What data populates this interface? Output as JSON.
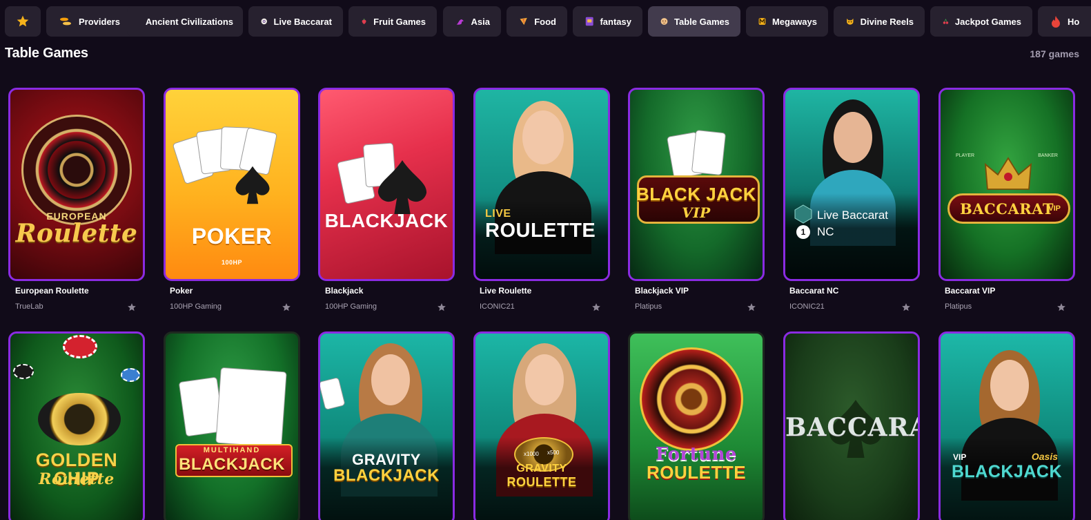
{
  "categories": [
    {
      "label": "",
      "icon": "star-icon",
      "color": "#f5b21b"
    },
    {
      "label": "Providers",
      "icon": "coins-icon",
      "color": "#f59e0b"
    },
    {
      "label": "Ancient Civilizations",
      "icon": "none",
      "color": ""
    },
    {
      "label": "Live Baccarat",
      "icon": "chip-icon",
      "color": "#e6e6e6"
    },
    {
      "label": "Fruit Games",
      "icon": "strawberry-icon",
      "color": "#e03c4e"
    },
    {
      "label": "Asia",
      "icon": "dragon-icon",
      "color": "#b83bd4"
    },
    {
      "label": "Food",
      "icon": "pizza-icon",
      "color": "#f0a43a"
    },
    {
      "label": "fantasy",
      "icon": "book-icon",
      "color": "#8a4dd6"
    },
    {
      "label": "Table Games",
      "icon": "dice-icon",
      "color": "#f2c48c"
    },
    {
      "label": "Megaways",
      "icon": "m-icon",
      "color": "#f5b21b"
    },
    {
      "label": "Divine Reels",
      "icon": "helmet-icon",
      "color": "#f5b21b"
    },
    {
      "label": "Jackpot Games",
      "icon": "cherry-icon",
      "color": "#e03c4e"
    },
    {
      "label": "Ho",
      "icon": "fire-icon",
      "color": "#e8443a"
    }
  ],
  "active_category": "Table Games",
  "section": {
    "title": "Table Games",
    "count": "187 games"
  },
  "games": [
    {
      "name": "European Roulette",
      "provider": "TrueLab",
      "art_lines": [
        "EUROPEAN",
        "Roulette"
      ]
    },
    {
      "name": "Poker",
      "provider": "100HP Gaming",
      "art_lines": [
        "POKER",
        "100HP"
      ]
    },
    {
      "name": "Blackjack",
      "provider": "100HP Gaming",
      "art_lines": [
        "BLACKJACK"
      ]
    },
    {
      "name": "Live Roulette",
      "provider": "ICONIC21",
      "art_lines": [
        "LIVE",
        "ROULETTE"
      ]
    },
    {
      "name": "Blackjack VIP",
      "provider": "Platipus",
      "art_lines": [
        "BLACK JACK",
        "VIP"
      ]
    },
    {
      "name": "Baccarat NC",
      "provider": "ICONIC21",
      "art_lines": [
        "Live Baccarat",
        "NC",
        "1"
      ]
    },
    {
      "name": "Baccarat VIP",
      "provider": "Platipus",
      "art_lines": [
        "BACCARAT",
        "VIP",
        "PLAYER",
        "BANKER"
      ]
    },
    {
      "name": "",
      "provider": "",
      "art_lines": [
        "GOLDEN CHIP",
        "Roulette"
      ]
    },
    {
      "name": "",
      "provider": "",
      "art_lines": [
        "MULTIHAND",
        "BLACKJACK"
      ]
    },
    {
      "name": "",
      "provider": "",
      "art_lines": [
        "GRAVITY",
        "BLACKJACK"
      ]
    },
    {
      "name": "",
      "provider": "",
      "art_lines": [
        "x1000",
        "x500",
        "GRAVITY",
        "ROULETTE"
      ]
    },
    {
      "name": "",
      "provider": "",
      "art_lines": [
        "Fortune",
        "ROULETTE"
      ]
    },
    {
      "name": "",
      "provider": "",
      "art_lines": [
        "BACCARAT"
      ]
    },
    {
      "name": "",
      "provider": "",
      "art_lines": [
        "VIP",
        "Oasis",
        "BLACKJACK"
      ]
    }
  ]
}
